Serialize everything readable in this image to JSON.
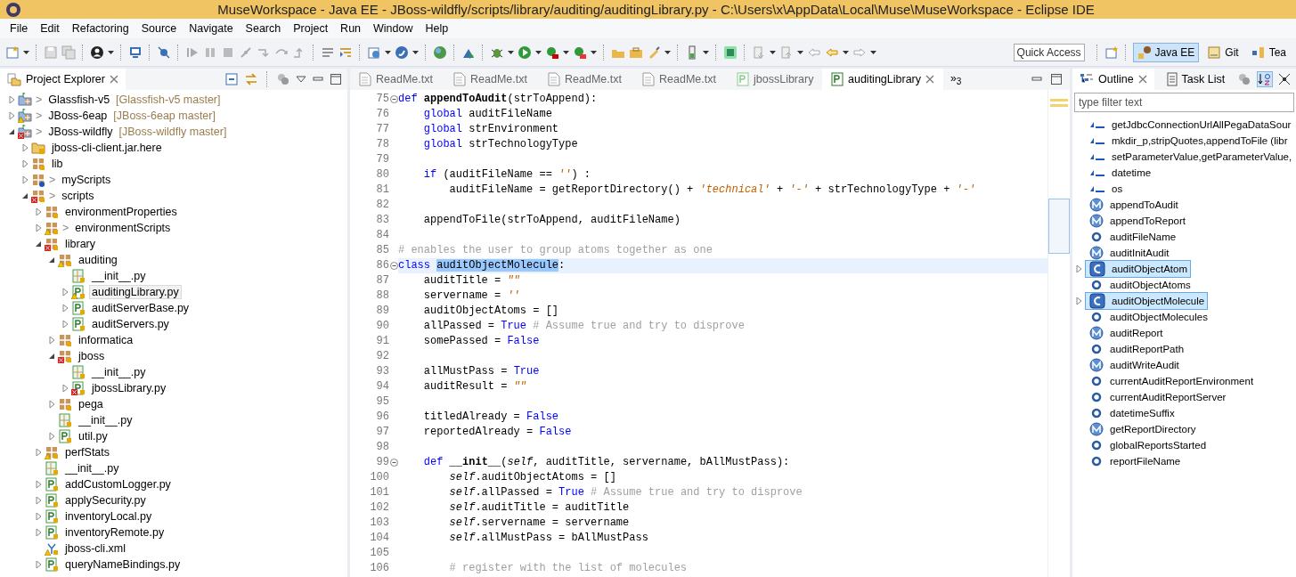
{
  "window": {
    "title": "MuseWorkspace - Java EE - JBoss-wildfly/scripts/library/auditing/auditingLibrary.py - C:\\Users\\x\\AppData\\Local\\Muse\\MuseWorkspace - Eclipse IDE"
  },
  "menu": [
    "File",
    "Edit",
    "Refactoring",
    "Source",
    "Navigate",
    "Search",
    "Project",
    "Run",
    "Window",
    "Help"
  ],
  "quick_access": {
    "placeholder": "Quick Access"
  },
  "perspectives": [
    {
      "label": "Java EE",
      "selected": true
    },
    {
      "label": "Git",
      "selected": false
    },
    {
      "label": "Tea",
      "selected": false
    }
  ],
  "project_explorer": {
    "title": "Project Explorer",
    "items": [
      {
        "label": "Glassfish-v5",
        "decoration": ">",
        "branch": "[Glassfish-v5 master]",
        "kind": "project",
        "error": false,
        "warning": false,
        "untracked": false,
        "expanded": false,
        "selected": false
      },
      {
        "label": "JBoss-6eap",
        "decoration": ">",
        "branch": "[JBoss-6eap master]",
        "kind": "project",
        "error": false,
        "warning": true,
        "untracked": false,
        "expanded": false,
        "selected": false
      },
      {
        "label": "JBoss-wildfly",
        "decoration": ">",
        "branch": "[JBoss-wildfly master]",
        "kind": "project",
        "error": true,
        "warning": false,
        "untracked": false,
        "expanded": true,
        "selected": false,
        "children": [
          {
            "label": "jboss-cli-client.jar.here",
            "kind": "folder",
            "error": false,
            "warning": false,
            "untracked": false,
            "expanded": false,
            "selected": false
          },
          {
            "label": "lib",
            "kind": "package",
            "error": false,
            "warning": false,
            "untracked": false,
            "expanded": false,
            "selected": false
          },
          {
            "label": "myScripts",
            "decoration": ">",
            "kind": "package",
            "error": false,
            "warning": false,
            "untracked": true,
            "expanded": false,
            "selected": false
          },
          {
            "label": "scripts",
            "decoration": ">",
            "kind": "package",
            "error": true,
            "warning": false,
            "untracked": false,
            "expanded": true,
            "selected": false,
            "children": [
              {
                "label": "environmentProperties",
                "kind": "package",
                "error": false,
                "warning": false,
                "untracked": false,
                "expanded": false,
                "selected": false
              },
              {
                "label": "environmentScripts",
                "decoration": ">",
                "kind": "package",
                "error": false,
                "warning": true,
                "untracked": false,
                "expanded": false,
                "selected": false
              },
              {
                "label": "library",
                "kind": "package",
                "error": true,
                "warning": false,
                "untracked": false,
                "expanded": true,
                "selected": false,
                "children": [
                  {
                    "label": "auditing",
                    "kind": "package",
                    "error": false,
                    "warning": true,
                    "untracked": false,
                    "expanded": true,
                    "selected": false,
                    "children": [
                      {
                        "label": "__init__.py",
                        "kind": "init",
                        "error": false,
                        "warning": false,
                        "untracked": false,
                        "selected": false
                      },
                      {
                        "label": "auditingLibrary.py",
                        "kind": "module",
                        "error": false,
                        "warning": true,
                        "untracked": false,
                        "expanded": false,
                        "selected": true
                      },
                      {
                        "label": "auditServerBase.py",
                        "kind": "module",
                        "error": false,
                        "warning": false,
                        "untracked": false,
                        "expanded": false,
                        "selected": false
                      },
                      {
                        "label": "auditServers.py",
                        "kind": "module",
                        "error": false,
                        "warning": false,
                        "untracked": false,
                        "expanded": false,
                        "selected": false
                      }
                    ]
                  },
                  {
                    "label": "informatica",
                    "kind": "package",
                    "error": false,
                    "warning": false,
                    "untracked": false,
                    "expanded": false,
                    "selected": false
                  },
                  {
                    "label": "jboss",
                    "kind": "package",
                    "error": true,
                    "warning": false,
                    "untracked": false,
                    "expanded": true,
                    "selected": false,
                    "children": [
                      {
                        "label": "__init__.py",
                        "kind": "init",
                        "error": false,
                        "warning": false,
                        "untracked": false,
                        "selected": false
                      },
                      {
                        "label": "jbossLibrary.py",
                        "kind": "module",
                        "error": true,
                        "warning": false,
                        "untracked": false,
                        "expanded": false,
                        "selected": false
                      }
                    ]
                  },
                  {
                    "label": "pega",
                    "kind": "package",
                    "error": false,
                    "warning": false,
                    "untracked": false,
                    "expanded": false,
                    "selected": false
                  },
                  {
                    "label": "__init__.py",
                    "kind": "init",
                    "error": false,
                    "warning": false,
                    "untracked": false,
                    "selected": false
                  },
                  {
                    "label": "util.py",
                    "kind": "module",
                    "error": false,
                    "warning": false,
                    "untracked": false,
                    "expanded": false,
                    "selected": false
                  }
                ]
              },
              {
                "label": "perfStats",
                "kind": "package",
                "error": false,
                "warning": true,
                "untracked": false,
                "expanded": false,
                "selected": false
              },
              {
                "label": "__init__.py",
                "kind": "init",
                "error": false,
                "warning": false,
                "untracked": false,
                "selected": false
              },
              {
                "label": "addCustomLogger.py",
                "kind": "module",
                "error": false,
                "warning": false,
                "untracked": false,
                "expanded": false,
                "selected": false
              },
              {
                "label": "applySecurity.py",
                "kind": "module",
                "error": false,
                "warning": false,
                "untracked": false,
                "expanded": false,
                "selected": false
              },
              {
                "label": "inventoryLocal.py",
                "kind": "module",
                "error": false,
                "warning": false,
                "untracked": false,
                "expanded": false,
                "selected": false
              },
              {
                "label": "inventoryRemote.py",
                "kind": "module",
                "error": false,
                "warning": false,
                "untracked": false,
                "expanded": false,
                "selected": false
              },
              {
                "label": "jboss-cli.xml",
                "kind": "xml",
                "error": false,
                "warning": true,
                "untracked": false,
                "selected": false
              },
              {
                "label": "queryNameBindings.py",
                "kind": "module",
                "error": false,
                "warning": false,
                "untracked": false,
                "expanded": false,
                "selected": false
              }
            ]
          }
        ]
      }
    ]
  },
  "editor": {
    "tabs": [
      {
        "label": "ReadMe.txt",
        "kind": "text",
        "selected": false
      },
      {
        "label": "ReadMe.txt",
        "kind": "text",
        "selected": false
      },
      {
        "label": "ReadMe.txt",
        "kind": "text",
        "selected": false
      },
      {
        "label": "ReadMe.txt",
        "kind": "text",
        "selected": false
      },
      {
        "label": "jbossLibrary",
        "kind": "python",
        "selected": false
      },
      {
        "label": "auditingLibrary",
        "kind": "python",
        "selected": true
      }
    ],
    "overflow": "»$_{3}$",
    "lines": [
      {
        "number": "75",
        "fold": true,
        "tokens": [
          {
            "kind": "keyword",
            "text": "def"
          },
          {
            "kind": "function",
            "text": " appendToAudit"
          },
          {
            "kind": "plain",
            "text": "(strToAppend):"
          }
        ]
      },
      {
        "number": "76",
        "tokens": [
          {
            "kind": "keyword",
            "text": "    global"
          },
          {
            "kind": "plain",
            "text": " auditFileName"
          }
        ]
      },
      {
        "number": "77",
        "tokens": [
          {
            "kind": "keyword",
            "text": "    global"
          },
          {
            "kind": "plain",
            "text": " strEnvironment"
          }
        ]
      },
      {
        "number": "78",
        "tokens": [
          {
            "kind": "keyword",
            "text": "    global"
          },
          {
            "kind": "plain",
            "text": " strTechnologyType"
          }
        ]
      },
      {
        "number": "79"
      },
      {
        "number": "80",
        "tokens": [
          {
            "kind": "keyword",
            "text": "    if"
          },
          {
            "kind": "plain",
            "text": " (auditFileName == "
          },
          {
            "kind": "string",
            "text": "''"
          },
          {
            "kind": "plain",
            "text": ") :"
          }
        ]
      },
      {
        "number": "81",
        "tokens": [
          {
            "kind": "plain",
            "text": "        auditFileName = getReportDirectory() + "
          },
          {
            "kind": "string",
            "text": "'technical'"
          },
          {
            "kind": "plain",
            "text": " + "
          },
          {
            "kind": "string",
            "text": "'-'"
          },
          {
            "kind": "plain",
            "text": " + strTechnologyType + "
          },
          {
            "kind": "string",
            "text": "'-'"
          }
        ]
      },
      {
        "number": "82"
      },
      {
        "number": "83",
        "tokens": [
          {
            "kind": "plain",
            "text": "    appendToFile(strToAppend, auditFileName)"
          }
        ]
      },
      {
        "number": "84"
      },
      {
        "number": "85",
        "tokens": [
          {
            "kind": "comment",
            "text": "# enables the user to group atoms together as one"
          }
        ]
      },
      {
        "number": "86",
        "fold": true,
        "current": true,
        "tokens": [
          {
            "kind": "keyword",
            "text": "class "
          },
          {
            "kind": "selection",
            "text": "auditObjectMolecule"
          },
          {
            "kind": "plain",
            "text": ":"
          }
        ]
      },
      {
        "number": "87",
        "tokens": [
          {
            "kind": "plain",
            "text": "    auditTitle = "
          },
          {
            "kind": "string",
            "text": "\"\""
          }
        ]
      },
      {
        "number": "88",
        "tokens": [
          {
            "kind": "plain",
            "text": "    servername = "
          },
          {
            "kind": "string",
            "text": "''"
          }
        ]
      },
      {
        "number": "89",
        "tokens": [
          {
            "kind": "plain",
            "text": "    auditObjectAtoms = []"
          }
        ]
      },
      {
        "number": "90",
        "tokens": [
          {
            "kind": "plain",
            "text": "    allPassed = "
          },
          {
            "kind": "keyword",
            "text": "True"
          },
          {
            "kind": "comment",
            "text": " # Assume true and try to disprove"
          }
        ]
      },
      {
        "number": "91",
        "tokens": [
          {
            "kind": "plain",
            "text": "    somePassed = "
          },
          {
            "kind": "keyword",
            "text": "False"
          }
        ]
      },
      {
        "number": "92"
      },
      {
        "number": "93",
        "tokens": [
          {
            "kind": "plain",
            "text": "    allMustPass = "
          },
          {
            "kind": "keyword",
            "text": "True"
          }
        ]
      },
      {
        "number": "94",
        "tokens": [
          {
            "kind": "plain",
            "text": "    auditResult = "
          },
          {
            "kind": "string",
            "text": "\"\""
          }
        ]
      },
      {
        "number": "95"
      },
      {
        "number": "96",
        "tokens": [
          {
            "kind": "plain",
            "text": "    titledAlready = "
          },
          {
            "kind": "keyword",
            "text": "False"
          }
        ]
      },
      {
        "number": "97",
        "tokens": [
          {
            "kind": "plain",
            "text": "    reportedAlready = "
          },
          {
            "kind": "keyword",
            "text": "False"
          }
        ]
      },
      {
        "number": "98"
      },
      {
        "number": "99",
        "fold": true,
        "tokens": [
          {
            "kind": "keyword",
            "text": "    def"
          },
          {
            "kind": "function",
            "text": " __init__"
          },
          {
            "kind": "plain",
            "text": "("
          },
          {
            "kind": "self",
            "text": "self"
          },
          {
            "kind": "plain",
            "text": ", auditTitle, servername, bAllMustPass):"
          }
        ]
      },
      {
        "number": "100",
        "tokens": [
          {
            "kind": "self",
            "text": "        self"
          },
          {
            "kind": "plain",
            "text": ".auditObjectAtoms = []"
          }
        ]
      },
      {
        "number": "101",
        "tokens": [
          {
            "kind": "self",
            "text": "        self"
          },
          {
            "kind": "plain",
            "text": ".allPassed = "
          },
          {
            "kind": "keyword",
            "text": "True"
          },
          {
            "kind": "comment",
            "text": " # Assume true and try to disprove"
          }
        ]
      },
      {
        "number": "102",
        "tokens": [
          {
            "kind": "self",
            "text": "        self"
          },
          {
            "kind": "plain",
            "text": ".auditTitle = auditTitle"
          }
        ]
      },
      {
        "number": "103",
        "tokens": [
          {
            "kind": "self",
            "text": "        self"
          },
          {
            "kind": "plain",
            "text": ".servername = servername"
          }
        ]
      },
      {
        "number": "104",
        "tokens": [
          {
            "kind": "self",
            "text": "        self"
          },
          {
            "kind": "plain",
            "text": ".allMustPass = bAllMustPass"
          }
        ]
      },
      {
        "number": "105"
      },
      {
        "number": "106",
        "tokens": [
          {
            "kind": "comment",
            "text": "        # register with the list of molecules"
          }
        ]
      }
    ]
  },
  "outline": {
    "title": "Outline",
    "second_tab": "Task List",
    "sort_on": true,
    "filter": {
      "placeholder": "type filter text"
    },
    "items": [
      {
        "label": "getJdbcConnectionUrlAllPegaDataSour",
        "kind": "import",
        "selected": false
      },
      {
        "label": "mkdir_p,stripQuotes,appendToFile (libr",
        "kind": "import",
        "selected": false
      },
      {
        "label": "setParameterValue,getParameterValue,",
        "kind": "import",
        "selected": false
      },
      {
        "label": "datetime",
        "kind": "import",
        "selected": false
      },
      {
        "label": "os",
        "kind": "import",
        "selected": false
      },
      {
        "label": "appendToAudit",
        "kind": "method",
        "selected": false
      },
      {
        "label": "appendToReport",
        "kind": "method",
        "selected": false
      },
      {
        "label": "auditFileName",
        "kind": "field",
        "selected": false
      },
      {
        "label": "auditInitAudit",
        "kind": "method",
        "selected": false
      },
      {
        "label": "auditObjectAtom",
        "kind": "class",
        "expanded": false,
        "selected": true
      },
      {
        "label": "auditObjectAtoms",
        "kind": "field",
        "selected": false
      },
      {
        "label": "auditObjectMolecule",
        "kind": "class",
        "expanded": false,
        "selected": true
      },
      {
        "label": "auditObjectMolecules",
        "kind": "field",
        "selected": false
      },
      {
        "label": "auditReport",
        "kind": "method",
        "selected": false
      },
      {
        "label": "auditReportPath",
        "kind": "field",
        "selected": false
      },
      {
        "label": "auditWriteAudit",
        "kind": "method",
        "selected": false
      },
      {
        "label": "currentAuditReportEnvironment",
        "kind": "field",
        "selected": false
      },
      {
        "label": "currentAuditReportServer",
        "kind": "field",
        "selected": false
      },
      {
        "label": "datetimeSuffix",
        "kind": "field",
        "selected": false
      },
      {
        "label": "getReportDirectory",
        "kind": "method",
        "selected": false
      },
      {
        "label": "globalReportsStarted",
        "kind": "field",
        "selected": false
      },
      {
        "label": "reportFileName",
        "kind": "field",
        "selected": false
      }
    ]
  }
}
